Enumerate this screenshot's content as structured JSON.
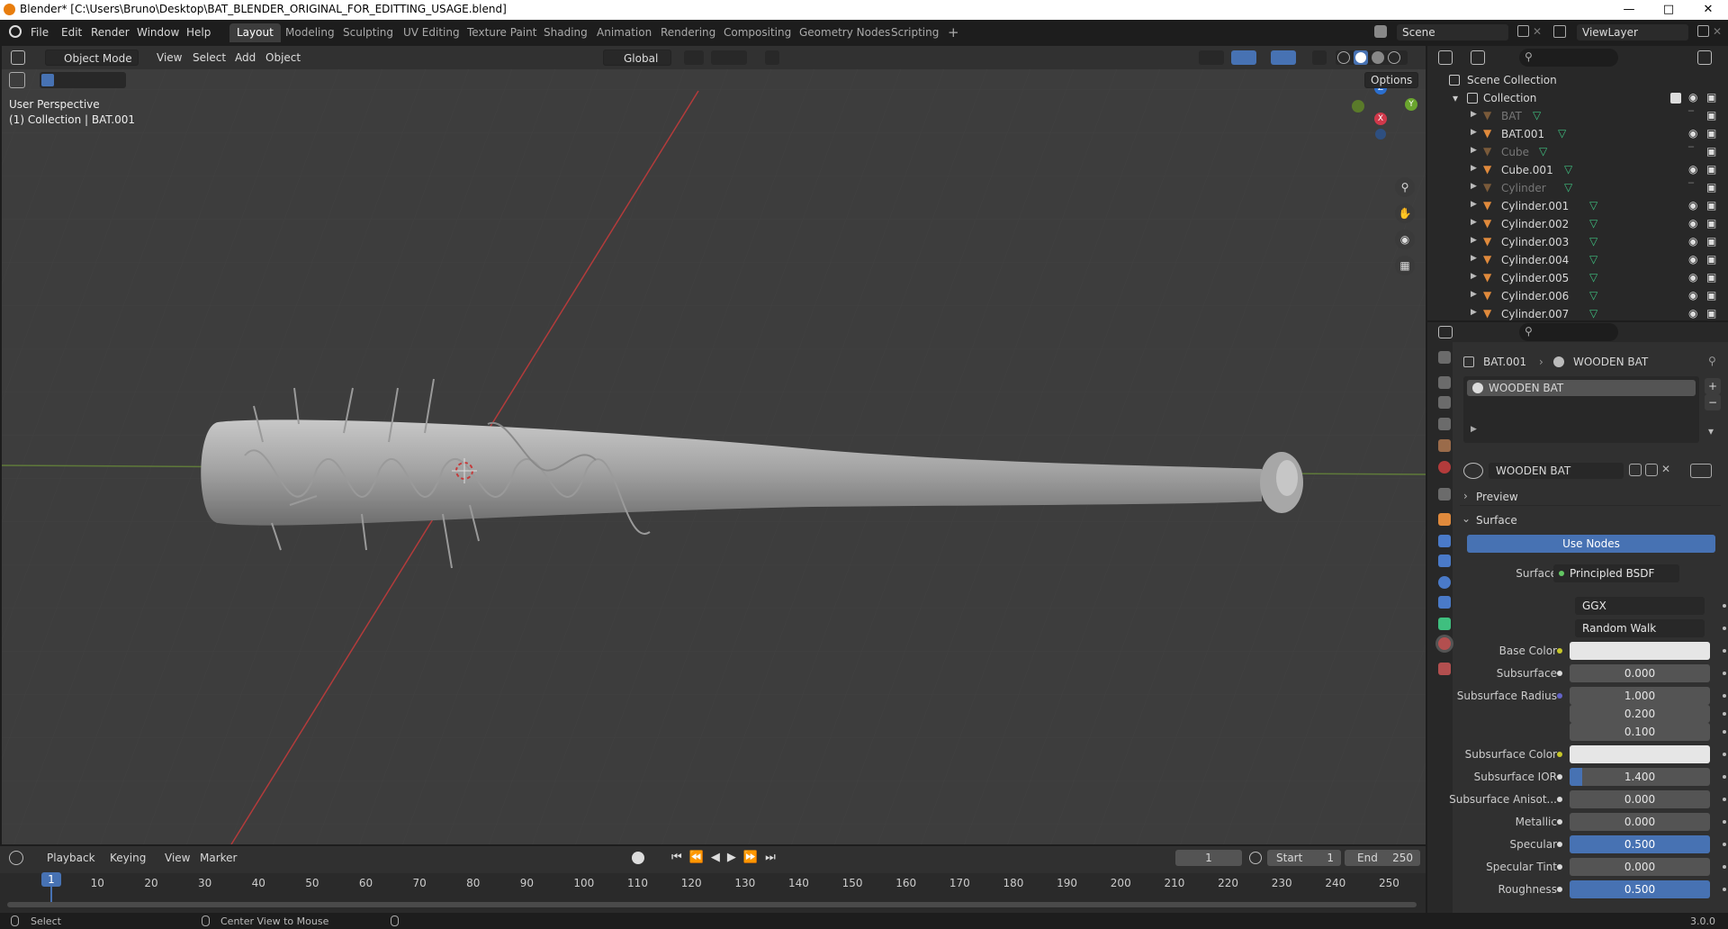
{
  "window": {
    "title": "Blender* [C:\\Users\\Bruno\\Desktop\\BAT_BLENDER_ORIGINAL_FOR_EDITTING_USAGE.blend]"
  },
  "menu": [
    "File",
    "Edit",
    "Render",
    "Window",
    "Help"
  ],
  "workspaces": [
    "Layout",
    "Modeling",
    "Sculpting",
    "UV Editing",
    "Texture Paint",
    "Shading",
    "Animation",
    "Rendering",
    "Compositing",
    "Geometry Nodes",
    "Scripting"
  ],
  "workspace_add": "+",
  "scene": {
    "name": "Scene",
    "view_layer": "ViewLayer"
  },
  "viewport": {
    "mode": "Object Mode",
    "menus": [
      "View",
      "Select",
      "Add",
      "Object"
    ],
    "transform_orientation": "Global",
    "options_label": "Options",
    "overlay_text_1": "User Perspective",
    "overlay_text_2": "(1) Collection | BAT.001",
    "gizmo_axes": {
      "x": "X",
      "y": "Y",
      "z": "Z"
    }
  },
  "timeline": {
    "menus": [
      "Playback",
      "Keying",
      "View",
      "Marker"
    ],
    "current_frame": "1",
    "start_label": "Start",
    "start": "1",
    "end_label": "End",
    "end": "250",
    "ticks": [
      "1",
      "10",
      "20",
      "30",
      "40",
      "50",
      "60",
      "70",
      "80",
      "90",
      "100",
      "110",
      "120",
      "130",
      "140",
      "150",
      "160",
      "170",
      "180",
      "190",
      "200",
      "210",
      "220",
      "230",
      "240",
      "250"
    ]
  },
  "statusbar": {
    "left": "Select",
    "middle": "Center View to Mouse",
    "version": "3.0.0"
  },
  "outliner": {
    "root": "Scene Collection",
    "collection": "Collection",
    "items": [
      {
        "name": "BAT",
        "dim": true
      },
      {
        "name": "BAT.001",
        "dim": false
      },
      {
        "name": "Cube",
        "dim": true
      },
      {
        "name": "Cube.001",
        "dim": false
      },
      {
        "name": "Cylinder",
        "dim": true
      },
      {
        "name": "Cylinder.001",
        "dim": false
      },
      {
        "name": "Cylinder.002",
        "dim": false
      },
      {
        "name": "Cylinder.003",
        "dim": false
      },
      {
        "name": "Cylinder.004",
        "dim": false
      },
      {
        "name": "Cylinder.005",
        "dim": false
      },
      {
        "name": "Cylinder.006",
        "dim": false
      },
      {
        "name": "Cylinder.007",
        "dim": false
      }
    ]
  },
  "properties": {
    "breadcrumb_object": "BAT.001",
    "breadcrumb_material": "WOODEN BAT",
    "slot": "WOODEN BAT",
    "material_name": "WOODEN BAT",
    "preview_label": "Preview",
    "surface_label": "Surface",
    "use_nodes": "Use Nodes",
    "surface_field_label": "Surface",
    "surface_shader": "Principled BSDF",
    "distribution": "GGX",
    "subsurface_method": "Random Walk",
    "rows": [
      {
        "label": "Base Color",
        "value": "",
        "kind": "white",
        "dot": "y"
      },
      {
        "label": "Subsurface",
        "value": "0.000",
        "kind": "",
        "dot": ""
      },
      {
        "label": "Subsurface Radius",
        "value": "1.000",
        "kind": "",
        "dot": "b"
      },
      {
        "label": "",
        "value": "0.200",
        "kind": "",
        "dot": "none"
      },
      {
        "label": "",
        "value": "0.100",
        "kind": "",
        "dot": "none"
      },
      {
        "label": "Subsurface Color",
        "value": "",
        "kind": "white",
        "dot": "y"
      },
      {
        "label": "Subsurface IOR",
        "value": "1.400",
        "kind": "ior",
        "dot": ""
      },
      {
        "label": "Subsurface Anisot...",
        "value": "0.000",
        "kind": "",
        "dot": ""
      },
      {
        "label": "Metallic",
        "value": "0.000",
        "kind": "",
        "dot": ""
      },
      {
        "label": "Specular",
        "value": "0.500",
        "kind": "blue",
        "dot": ""
      },
      {
        "label": "Specular Tint",
        "value": "0.000",
        "kind": "",
        "dot": ""
      },
      {
        "label": "Roughness",
        "value": "0.500",
        "kind": "blue",
        "dot": ""
      }
    ]
  },
  "colors": {
    "accent": "#4772b3",
    "object_orange": "#e08a3c",
    "mesh_green": "#3fbf7f"
  }
}
